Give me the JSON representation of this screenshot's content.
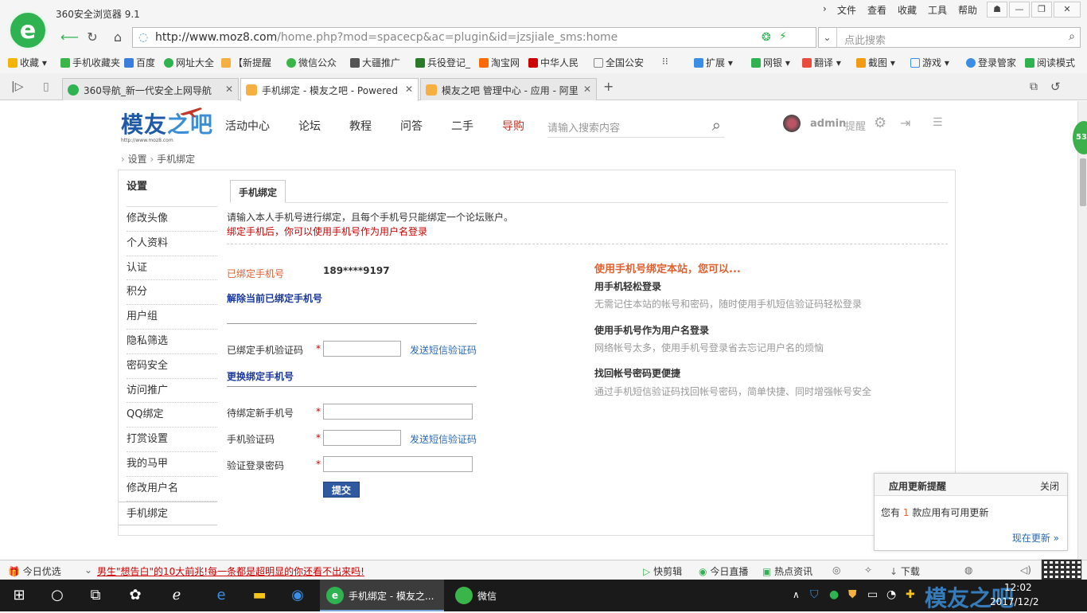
{
  "browser": {
    "title": "360安全浏览器 9.1",
    "menu": [
      "文件",
      "查看",
      "收藏",
      "工具",
      "帮助"
    ],
    "url_host": "http://www.moz8.com",
    "url_path": "/home.php?mod=spacecp&ac=plugin&id=jzsjiale_sms:home",
    "search_placeholder": "点此搜索"
  },
  "bookmarks": [
    "收藏",
    "手机收藏夹",
    "百度",
    "网址大全",
    "【新提醒",
    "微信公众",
    "大疆推广",
    "兵役登记_",
    "淘宝网",
    "中华人民",
    "全国公安"
  ],
  "bookmark_tools": [
    "扩展",
    "网银",
    "翻译",
    "截图",
    "游戏",
    "登录管家",
    "阅读模式"
  ],
  "tabs": [
    {
      "label": "360导航_新一代安全上网导航"
    },
    {
      "label": "手机绑定 - 模友之吧 - Powered"
    },
    {
      "label": "模友之吧 管理中心 - 应用 - 阿里"
    }
  ],
  "site": {
    "logo": "模友",
    "logo_accent": "之吧",
    "logo_sub": "http://www.moz8.com",
    "nav": [
      "活动中心",
      "论坛",
      "教程",
      "问答",
      "二手",
      "导购"
    ],
    "search_placeholder": "请输入搜索内容",
    "username": "admin",
    "remind": "提醒"
  },
  "breadcrumb": [
    "设置",
    "手机绑定"
  ],
  "sidebar": {
    "title": "设置",
    "items": [
      "修改头像",
      "个人资料",
      "认证",
      "积分",
      "用户组",
      "隐私筛选",
      "密码安全",
      "访问推广",
      "QQ绑定",
      "打赏设置",
      "我的马甲",
      "修改用户名",
      "手机绑定"
    ]
  },
  "content": {
    "tab": "手机绑定",
    "intro": "请输入本人手机号进行绑定，且每个手机号只能绑定一个论坛账户。",
    "notice": "绑定手机后，你可以使用手机号作为用户名登录",
    "bound_label": "已绑定手机号",
    "bound_value": "189****9197",
    "unbind_section": "解除当前已绑定手机号",
    "bound_code_label": "已绑定手机验证码",
    "send_code": "发送短信验证码",
    "change_section": "更换绑定手机号",
    "new_phone_label": "待绑定新手机号",
    "code_label": "手机验证码",
    "pwd_label": "验证登录密码",
    "required_mark": "*",
    "submit": "提交"
  },
  "benefits": {
    "title": "使用手机号绑定本站，您可以...",
    "items": [
      {
        "h": "用手机轻松登录",
        "d": "无需记住本站的帐号和密码，随时使用手机短信验证码轻松登录"
      },
      {
        "h": "使用手机号作为用户名登录",
        "d": "网络帐号太多，使用手机号登录省去忘记用户名的烦恼"
      },
      {
        "h": "找回帐号密码更便捷",
        "d": "通过手机短信验证码找回帐号密码，简单快捷、同时增强帐号安全"
      }
    ]
  },
  "popup": {
    "title": "应用更新提醒",
    "close": "关闭",
    "msg_pre": "您有",
    "count": "1",
    "msg_post": "款应用有可用更新",
    "action": "现在更新 »"
  },
  "statusbar": {
    "left": "今日优选",
    "news": "男生\"想告白\"的10大前兆!每一条都是超明显的你还看不出来吗!",
    "items": [
      "快剪辑",
      "今日直播",
      "热点资讯",
      "下载"
    ]
  },
  "taskbar": {
    "active_window": "手机绑定 - 模友之...",
    "wechat": "微信",
    "time": "12:02",
    "date": "2017/12/2"
  },
  "badge": "53",
  "colors": {
    "accent": "#2f5aa0",
    "red": "#cc0000",
    "orange": "#e06030",
    "link": "#2a6ab8"
  }
}
